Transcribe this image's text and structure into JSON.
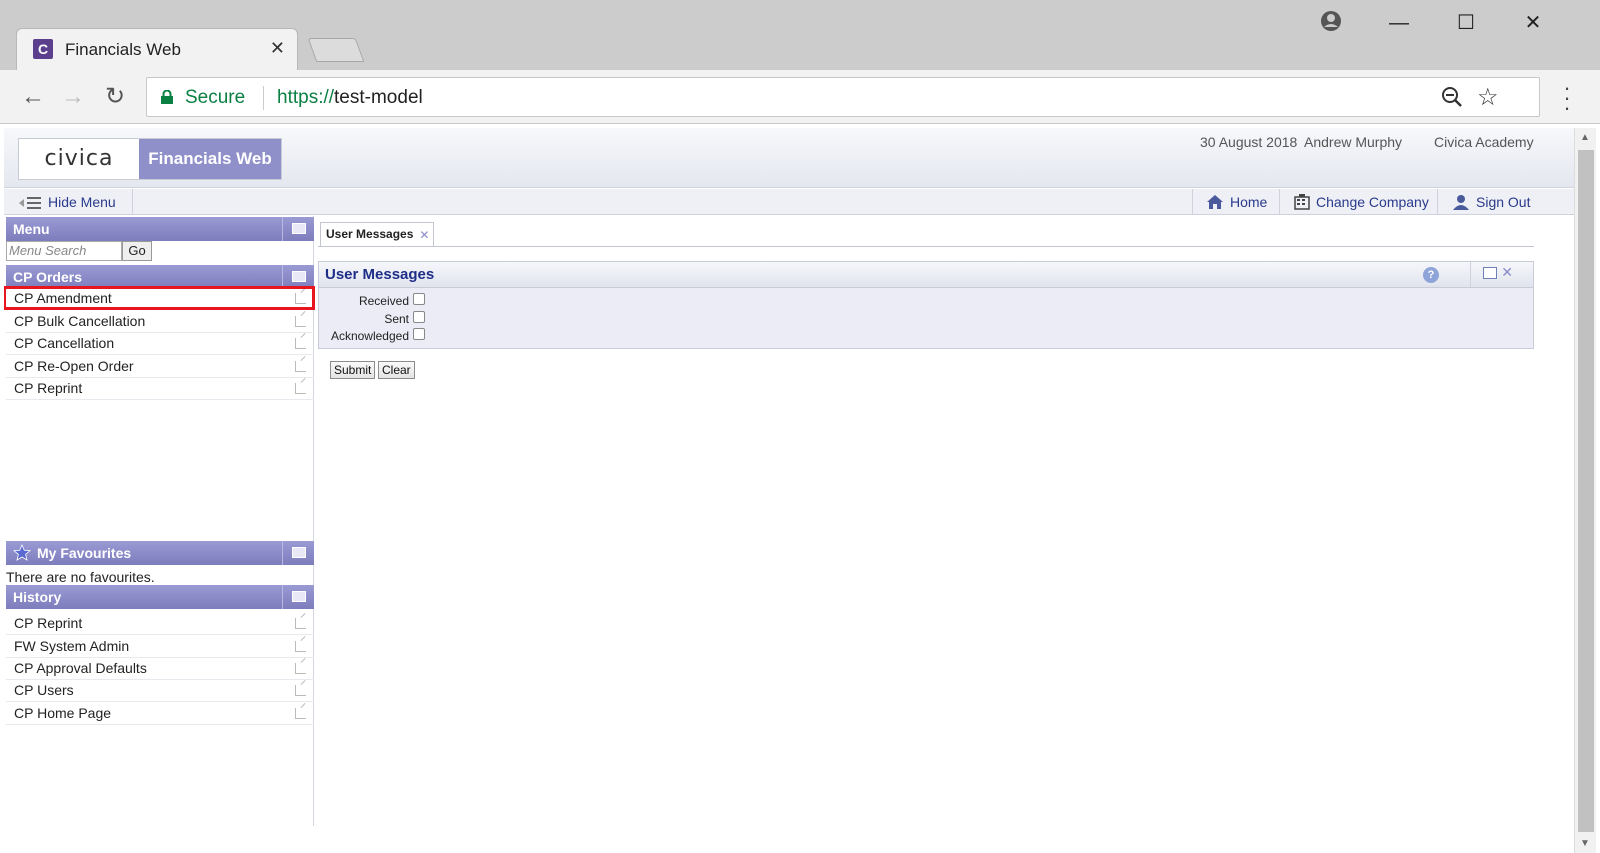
{
  "browser": {
    "tab_title": "Financials Web",
    "tab_favicon_letter": "C",
    "close_tab_glyph": "✕",
    "secure_label": "Secure",
    "url_scheme": "https://",
    "url_host": "test-model",
    "window_buttons": {
      "minimize": "—",
      "maximize": "☐",
      "close": "✕"
    },
    "nav_glyphs": {
      "back": "←",
      "forward": "→",
      "reload": "↻",
      "zoom": "⚲",
      "star": "☆",
      "account": "●"
    }
  },
  "header": {
    "logo_text": "civica",
    "product_name": "Financials Web",
    "date": "30 August 2018",
    "user": "Andrew Murphy",
    "company": "Civica Academy"
  },
  "appnav": {
    "hide_menu": "Hide Menu",
    "home": "Home",
    "change_company": "Change Company",
    "sign_out": "Sign Out"
  },
  "sidebar": {
    "menu_title": "Menu",
    "search_placeholder": "Menu Search",
    "go_label": "Go",
    "orders_title": "CP Orders",
    "orders": [
      "CP Amendment",
      "CP Bulk Cancellation",
      "CP Cancellation",
      "CP Re-Open Order",
      "CP Reprint"
    ],
    "favourites_title": "My Favourites",
    "no_favourites": "There are no favourites.",
    "history_title": "History",
    "history": [
      "CP Reprint",
      "FW System Admin",
      "CP Approval Defaults",
      "CP Users",
      "CP Home Page"
    ]
  },
  "main": {
    "tab_label": "User Messages",
    "section_title": "User Messages",
    "help_glyph": "?",
    "close_glyph": "✕",
    "filters": [
      "Received",
      "Sent",
      "Acknowledged"
    ],
    "submit_label": "Submit",
    "clear_label": "Clear"
  },
  "colors": {
    "panel_header": "#8a8acb",
    "link": "#2a3a8c",
    "highlight": "#e8141e",
    "secure_green": "#0b8043"
  }
}
